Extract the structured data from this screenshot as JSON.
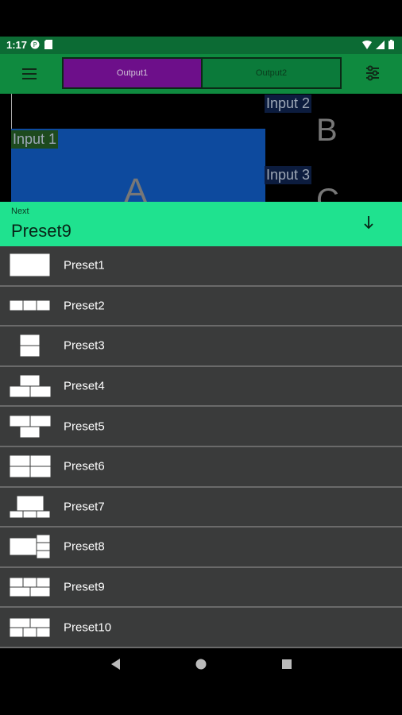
{
  "status_bar": {
    "time": "1:17",
    "icons_left": [
      "notification-icon",
      "sd-card-icon"
    ],
    "icons_right": [
      "wifi-icon",
      "signal-icon",
      "battery-icon"
    ]
  },
  "app_bar": {
    "menu_icon": "hamburger-menu-icon",
    "tabs": [
      {
        "label": "Output1",
        "active": true
      },
      {
        "label": "Output2",
        "active": false
      }
    ],
    "settings_icon": "tune-settings-icon",
    "accent": "#0f8a3f",
    "active_tab_color": "#6d0f8a"
  },
  "preview": {
    "inputs": [
      {
        "label": "Input 1",
        "letter": "A"
      },
      {
        "label": "Input 2",
        "letter": "B"
      },
      {
        "label": "Input 3",
        "letter": "C"
      }
    ],
    "block_color": "#0d4a9e"
  },
  "next": {
    "label": "Next",
    "value": "Preset9",
    "icon": "arrow-down-icon",
    "color": "#1fe28f"
  },
  "presets": [
    {
      "label": "Preset1",
      "icon": "preset1-layout-icon"
    },
    {
      "label": "Preset2",
      "icon": "preset2-layout-icon"
    },
    {
      "label": "Preset3",
      "icon": "preset3-layout-icon"
    },
    {
      "label": "Preset4",
      "icon": "preset4-layout-icon"
    },
    {
      "label": "Preset5",
      "icon": "preset5-layout-icon"
    },
    {
      "label": "Preset6",
      "icon": "preset6-layout-icon"
    },
    {
      "label": "Preset7",
      "icon": "preset7-layout-icon"
    },
    {
      "label": "Preset8",
      "icon": "preset8-layout-icon"
    },
    {
      "label": "Preset9",
      "icon": "preset9-layout-icon"
    },
    {
      "label": "Preset10",
      "icon": "preset10-layout-icon"
    }
  ],
  "nav_bar": {
    "icons": [
      "back-icon",
      "home-icon",
      "recents-icon"
    ]
  }
}
